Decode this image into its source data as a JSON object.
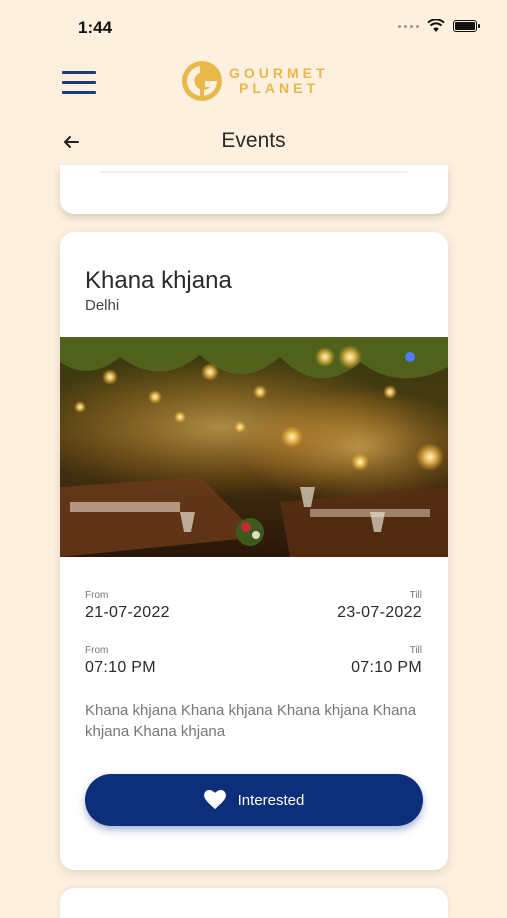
{
  "status_bar": {
    "time": "1:44"
  },
  "header": {
    "logo_line1": "GOURMET",
    "logo_line2": "PLANET"
  },
  "nav": {
    "title": "Events"
  },
  "event": {
    "name": "Khana khjana",
    "city": "Delhi",
    "date_from_label": "From",
    "date_from": "21-07-2022",
    "date_till_label": "Till",
    "date_till": "23-07-2022",
    "time_from_label": "From",
    "time_from": "07:10 PM",
    "time_till_label": "Till",
    "time_till": "07:10 PM",
    "description": "Khana khjana Khana khjana Khana khjana Khana khjana Khana khjana",
    "button_label": "Interested"
  },
  "colors": {
    "background": "#fdf0de",
    "primary": "#0d2f7a",
    "logo": "#e8b84a"
  },
  "icons": {
    "menu": "menu-icon",
    "back": "arrow-left-icon",
    "interested": "heart-icon"
  }
}
